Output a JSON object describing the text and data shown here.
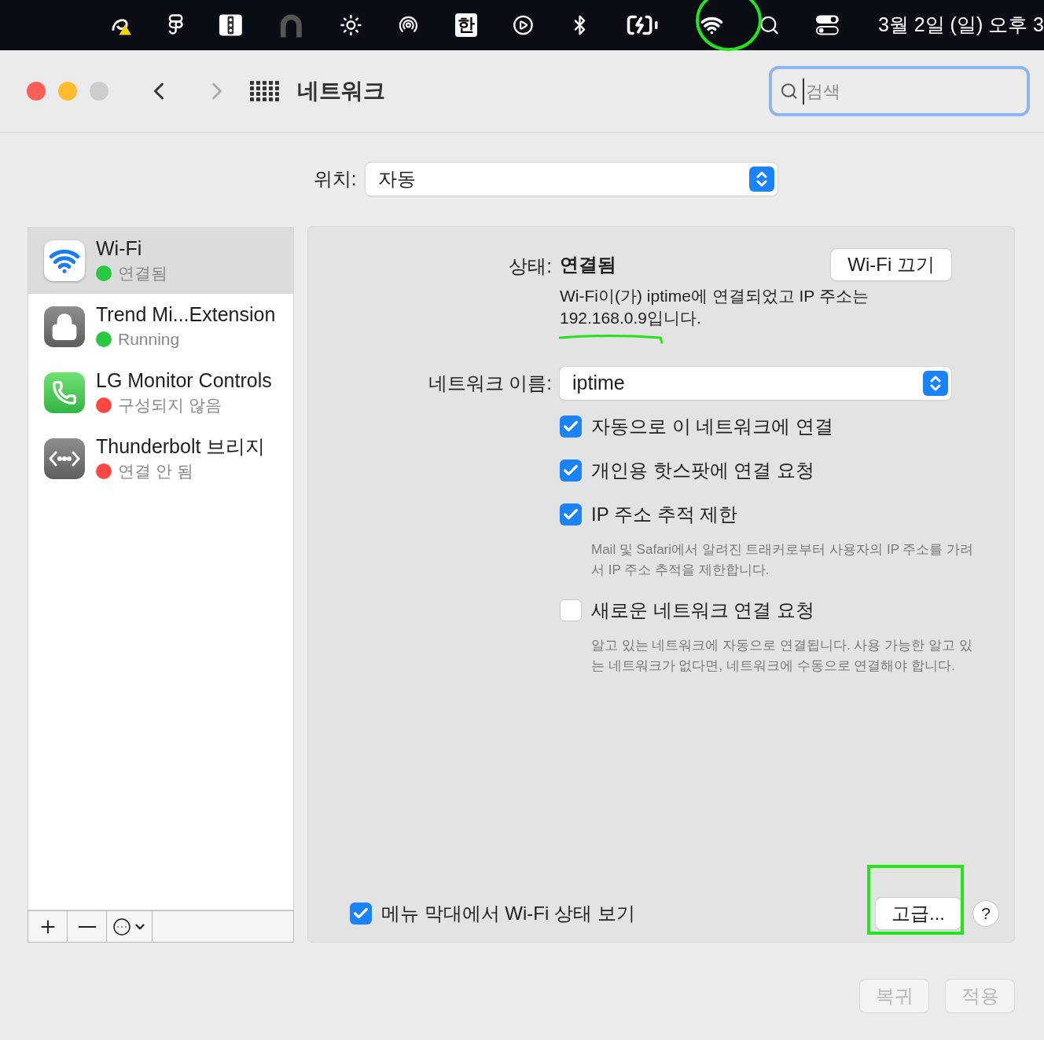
{
  "menu_bar": {
    "input_source": "한",
    "clock": "3월 2일 (일) 오후 3"
  },
  "toolbar": {
    "title": "네트워크",
    "search": {
      "placeholder": "검색"
    }
  },
  "location": {
    "label": "위치:",
    "value": "자동"
  },
  "services": [
    {
      "name": "Wi-Fi",
      "status": "연결됨",
      "color": "#28c840",
      "selected": true,
      "kind": "wifi"
    },
    {
      "name": "Trend Mi...Extension",
      "status": "Running",
      "color": "#28c840",
      "selected": false,
      "kind": "lock"
    },
    {
      "name": "LG Monitor Controls",
      "status": "구성되지 않음",
      "color": "#ff4742",
      "selected": false,
      "kind": "phone"
    },
    {
      "name": "Thunderbolt 브리지",
      "status": "연결 안 됨",
      "color": "#ff4742",
      "selected": false,
      "kind": "bridge"
    }
  ],
  "detail": {
    "status_label": "상태:",
    "status_value": "연결됨",
    "toggle_button": "Wi-Fi 끄기",
    "status_description": "Wi-Fi이(가) iptime에 연결되었고 IP 주소는 192.168.0.9입니다.",
    "network_name_label": "네트워크 이름:",
    "network_name": "iptime",
    "options": [
      {
        "label": "자동으로 이 네트워크에 연결",
        "checked": true
      },
      {
        "label": "개인용 핫스팟에 연결 요청",
        "checked": true
      },
      {
        "label": "IP 주소 추적 제한",
        "checked": true,
        "description": "Mail 및 Safari에서 알려진 트래커로부터 사용자의 IP 주소를 가려서 IP 주소 추적을 제한합니다."
      },
      {
        "label": "새로운 네트워크 연결 요청",
        "checked": false,
        "description": "알고 있는 네트워크에 자동으로 연결됩니다. 사용 가능한 알고 있는 네트워크가 없다면, 네트워크에 수동으로 연결해야 합니다."
      }
    ],
    "show_in_menu_bar": {
      "label": "메뉴 막대에서 Wi-Fi 상태 보기",
      "checked": true
    },
    "advanced_button": "고급...",
    "help_button": "?"
  },
  "footer_buttons": [
    {
      "label": "복귀",
      "disabled": true
    },
    {
      "label": "적용",
      "disabled": true
    }
  ]
}
